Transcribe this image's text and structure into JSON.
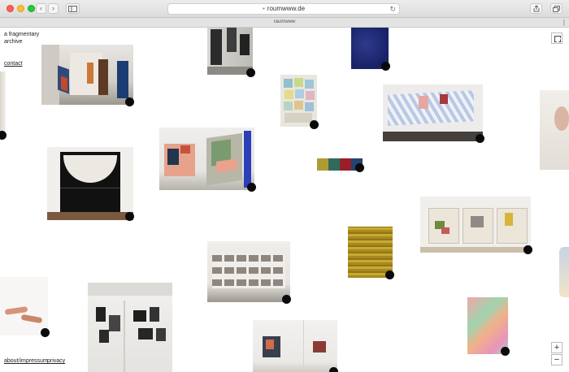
{
  "browser": {
    "url": "roumwww.de",
    "tab_title": "raumwww",
    "back_label": "‹",
    "forward_label": "›"
  },
  "site": {
    "title": "a fragmentary archive",
    "contact_label": "contact",
    "about_label": "about/impressum",
    "privacy_label": "privacy"
  },
  "controls": {
    "zoom_in_label": "+",
    "zoom_out_label": "−"
  },
  "colors": {
    "dot": "#0b0b0b",
    "background": "#ffffff"
  }
}
